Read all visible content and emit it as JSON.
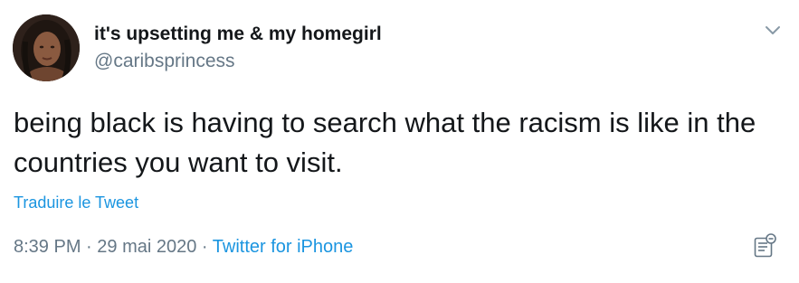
{
  "author": {
    "display_name": "it's upsetting me & my homegirl",
    "handle": "@caribsprincess"
  },
  "tweet": {
    "text": "being black is having to search what the racism is like in the countries you want to visit.",
    "translate_label": "Traduire le Tweet",
    "time": "8:39 PM",
    "separator_1": " · ",
    "date": "29 mai 2020",
    "separator_2": " · ",
    "source": "Twitter for iPhone"
  },
  "icons": {
    "menu": "chevron-down-icon",
    "analytics": "analytics-icon"
  },
  "colors": {
    "text": "#14171a",
    "secondary": "#657786",
    "link": "#1b95e0"
  }
}
